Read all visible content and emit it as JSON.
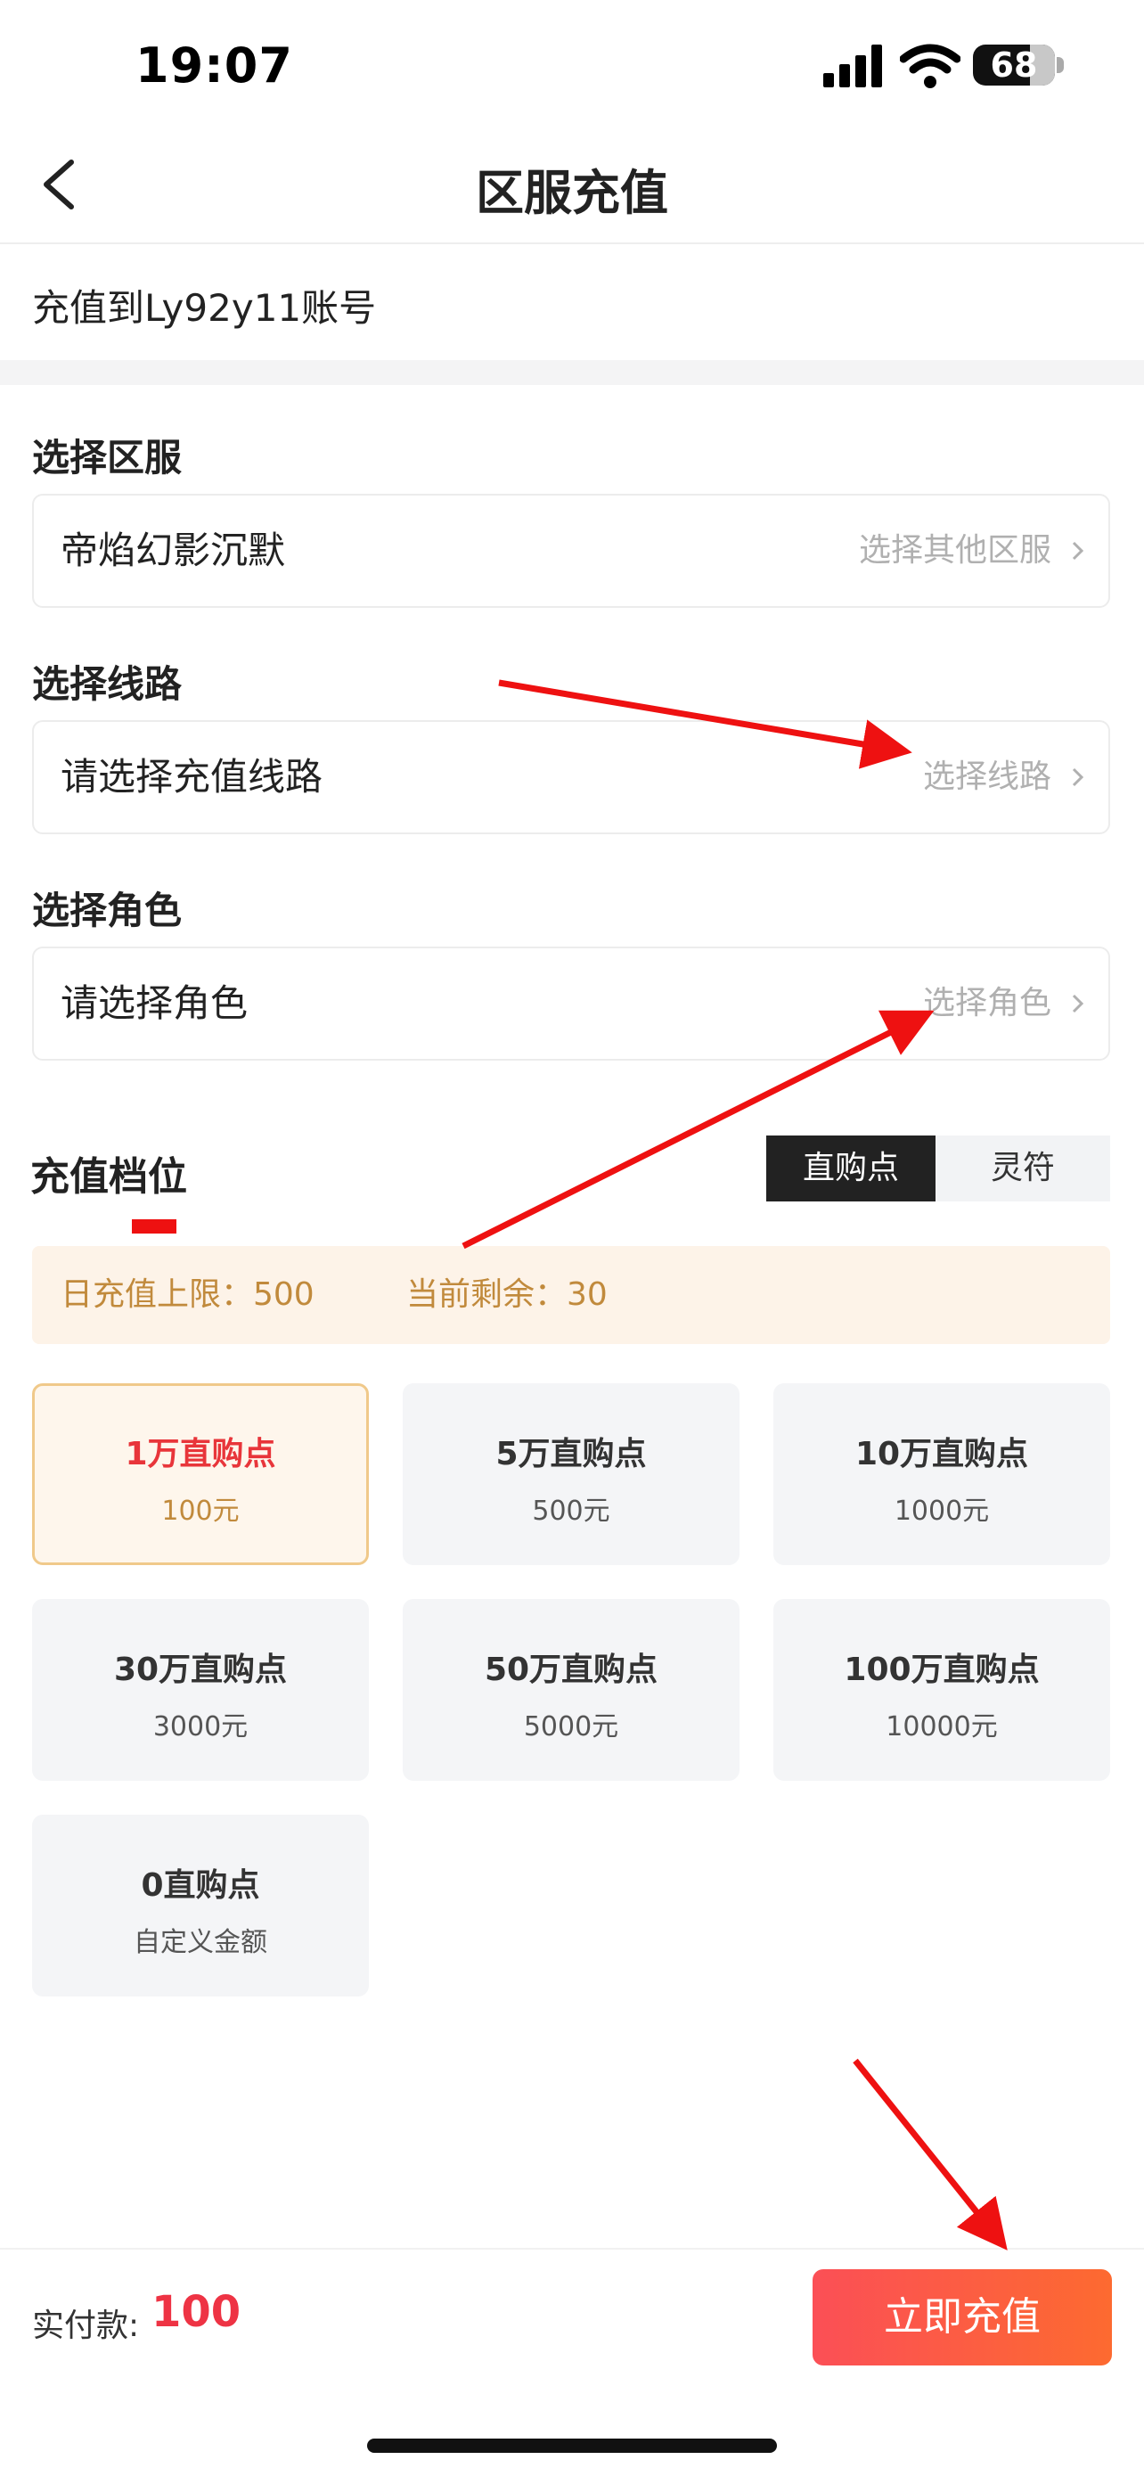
{
  "status_bar": {
    "time": "19:07",
    "battery": "68"
  },
  "nav": {
    "title": "区服充值"
  },
  "account": {
    "text": "充值到Ly92y11账号"
  },
  "server": {
    "label": "选择区服",
    "value": "帝焰幻影沉默",
    "action": "选择其他区服"
  },
  "route": {
    "label": "选择线路",
    "value": "请选择充值线路",
    "action": "选择线路"
  },
  "role": {
    "label": "选择角色",
    "value": "请选择角色",
    "action": "选择角色"
  },
  "tiers": {
    "title": "充值档位",
    "tabs": [
      "直购点",
      "灵符"
    ],
    "limit": "日充值上限：500",
    "remaining": "当前剩余：30",
    "options": [
      {
        "name": "1万直购点",
        "price": "100元"
      },
      {
        "name": "5万直购点",
        "price": "500元"
      },
      {
        "name": "10万直购点",
        "price": "1000元"
      },
      {
        "name": "30万直购点",
        "price": "3000元"
      },
      {
        "name": "50万直购点",
        "price": "5000元"
      },
      {
        "name": "100万直购点",
        "price": "10000元"
      },
      {
        "name": "0直购点",
        "price": "自定义金额"
      }
    ]
  },
  "footer": {
    "pay_label": "实付款:",
    "pay_amount": "100",
    "button": "立即充值"
  },
  "colors": {
    "accent_red": "#ee3344",
    "gold": "#c18a3c",
    "button_start": "#fb4f56",
    "button_end": "#fd6a30",
    "annotation_arrow": "#ee1111"
  }
}
